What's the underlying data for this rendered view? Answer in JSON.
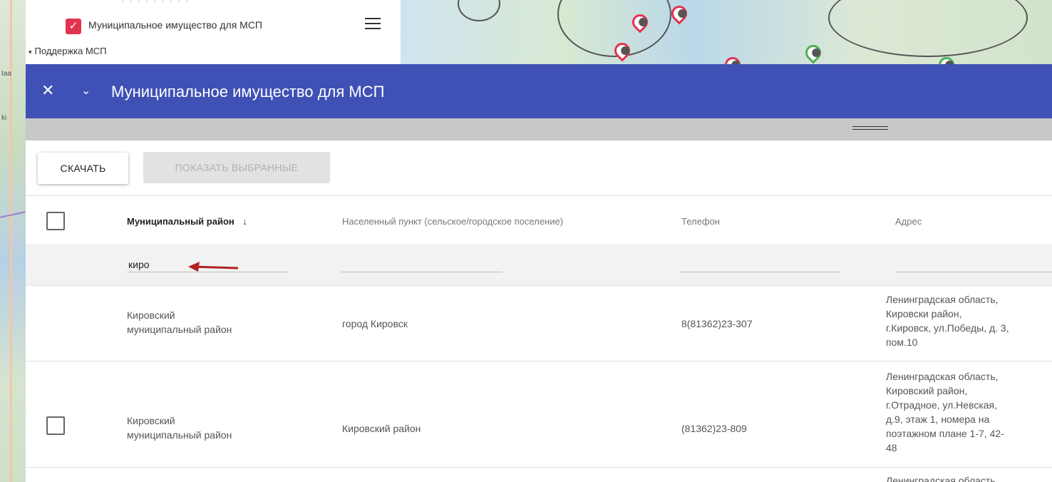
{
  "layer_panel": {
    "cut_text": "· · · · · · · · ·",
    "checked_label": "Муниципальное имущество для МСП",
    "group_label": "Поддержка МСП",
    "menu_icon": "hamburger-menu-icon",
    "check_icon": "✓",
    "triangle_icon": "▾"
  },
  "left_strip": {
    "label_a": "taa",
    "label_b": "ki"
  },
  "dialog": {
    "title": "Муниципальное имущество для МСП",
    "close_icon": "✕",
    "collapse_icon": "⌄",
    "accent": "#3f51b5"
  },
  "toolbar": {
    "download_label": "СКАЧАТЬ",
    "show_selected_label": "ПОКАЗАТЬ ВЫБРАННЫЕ"
  },
  "table": {
    "columns": [
      {
        "label": "Муниципальный район",
        "sort_icon": "↓"
      },
      {
        "label": "Населенный пункт (сельское/городское поселение)"
      },
      {
        "label": "Телефон"
      },
      {
        "label": "Адрес"
      }
    ],
    "filter_value": "киро",
    "rows": [
      {
        "district": [
          "Кировский",
          "муниципальный район"
        ],
        "settlement": "город Кировск",
        "phone": "8(81362)23-307",
        "address": [
          "Ленинградская область,",
          "Кировски район,",
          "г.Кировск, ул.Победы, д. 3,",
          "пом.10"
        ]
      },
      {
        "district": [
          "Кировский",
          "муниципальный район"
        ],
        "settlement": "Кировский район",
        "phone": "(81362)23-809",
        "address": [
          "Ленинградская область,",
          "Кировский район,",
          "г.Отрадное, ул.Невская,",
          "д.9, этаж 1, номера на",
          "поэтажном плане 1-7, 42-",
          "48"
        ]
      },
      {
        "address": [
          "Ленинградская область"
        ]
      }
    ]
  },
  "colors": {
    "pin_red": "#e2334f",
    "pin_green": "#4caf50",
    "arrow": "#b22222"
  }
}
